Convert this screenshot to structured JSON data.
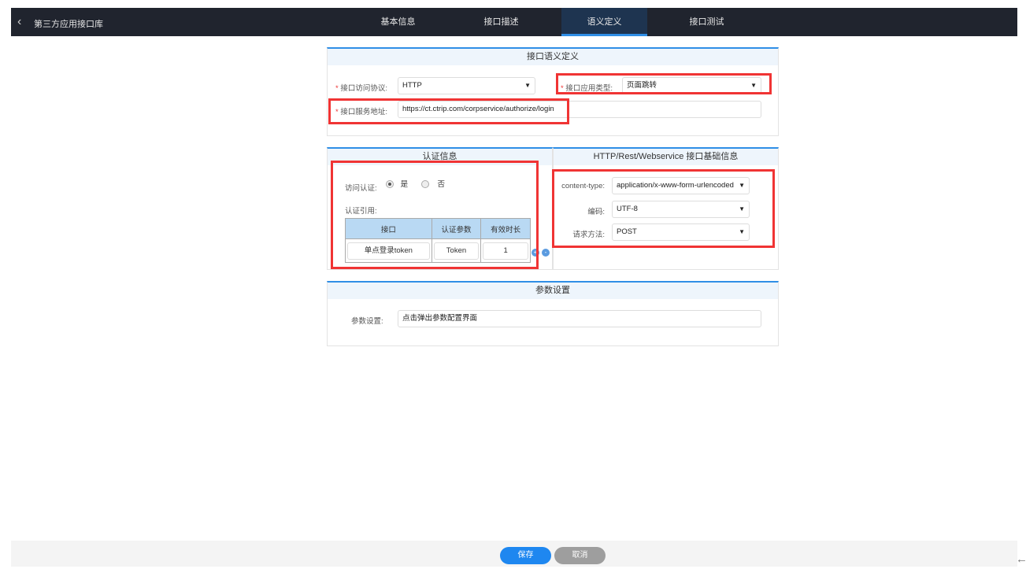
{
  "nav": {
    "back_title": "第三方应用接口库",
    "tabs": [
      "基本信息",
      "接口描述",
      "语义定义",
      "接口测试"
    ],
    "active_tab": "语义定义"
  },
  "semantic": {
    "title": "接口语义定义",
    "protocol_label": "接口访问协议:",
    "protocol_value": "HTTP",
    "app_type_label": "接口应用类型:",
    "app_type_value": "页面跳转",
    "url_label": "接口服务地址:",
    "url_value": "https://ct.ctrip.com/corpservice/authorize/login",
    "required_mark": "*"
  },
  "auth": {
    "title": "认证信息",
    "access_label": "访问认证:",
    "yes": "是",
    "no": "否",
    "selected": "是",
    "ref_label": "认证引用:",
    "columns": [
      "接口",
      "认证参数",
      "有效时长"
    ],
    "rows": [
      [
        "单点登录token",
        "Token",
        "1"
      ]
    ],
    "add": "+",
    "remove": "-"
  },
  "http": {
    "title": "HTTP/Rest/Webservice 接口基础信息",
    "content_type_label": "content-type:",
    "content_type_value": "application/x-www-form-urlencoded",
    "encoding_label": "编码:",
    "encoding_value": "UTF-8",
    "method_label": "请求方法:",
    "method_value": "POST"
  },
  "params": {
    "title": "参数设置",
    "label": "参数设置:",
    "value": "点击弹出参数配置界面"
  },
  "footer": {
    "save": "保存",
    "cancel": "取消"
  },
  "colors": {
    "accent": "#2f8ee6",
    "nav_bg": "#20242e",
    "highlight": "#f03434"
  }
}
